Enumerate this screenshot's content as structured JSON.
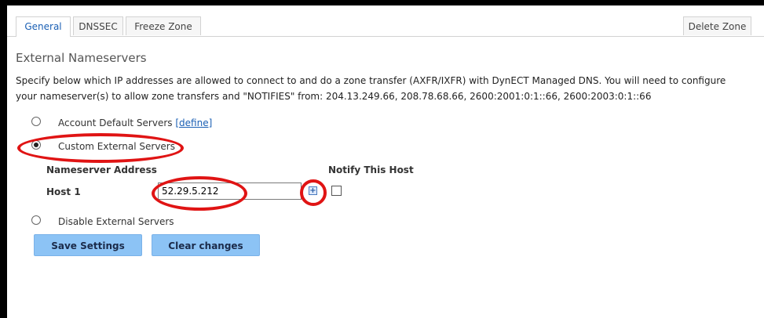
{
  "tabs": [
    "General",
    "DNSSEC",
    "Freeze Zone"
  ],
  "delete_zone": "Delete Zone",
  "section_title": "External Nameservers",
  "description": "Specify below which IP addresses are allowed to connect to and do a zone transfer (AXFR/IXFR) with DynECT Managed DNS. You will need to configure your nameserver(s) to allow zone transfers and \"NOTIFIES\" from: 204.13.249.66, 208.78.68.66, 2600:2001:0:1::66, 2600:2003:0:1::66",
  "options": {
    "account_default": {
      "label": "Account Default Servers",
      "link": "[define]"
    },
    "custom": {
      "label": "Custom External Servers",
      "selected": true
    },
    "disable": {
      "label": "Disable External Servers"
    }
  },
  "table": {
    "col_address": "Nameserver Address",
    "col_notify": "Notify This Host",
    "host_label": "Host 1",
    "host_value": "52.29.5.212"
  },
  "buttons": {
    "save": "Save Settings",
    "clear": "Clear changes"
  },
  "colors": {
    "button": "#8cc3f5",
    "annotation": "#e01414",
    "link": "#1a5fb4"
  }
}
